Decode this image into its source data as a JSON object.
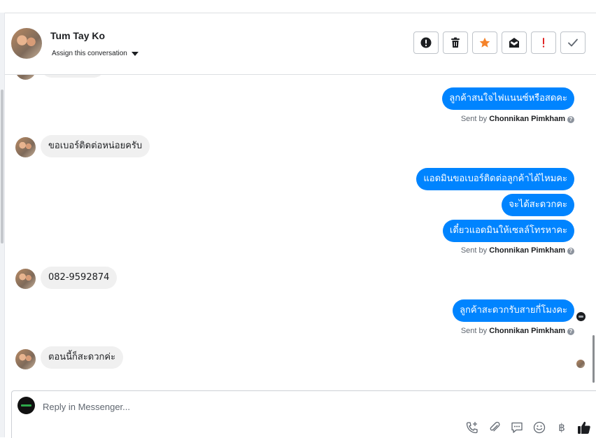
{
  "header": {
    "contact_name": "Tum Tay Ko",
    "assign_label": "Assign this conversation",
    "actions": [
      {
        "name": "spam-button",
        "icon": "alert-circle-icon"
      },
      {
        "name": "delete-button",
        "icon": "trash-icon"
      },
      {
        "name": "star-button",
        "icon": "star-icon",
        "color": "#f5832a"
      },
      {
        "name": "mark-unread-button",
        "icon": "mail-icon"
      },
      {
        "name": "follow-up-button",
        "icon": "exclamation-icon",
        "color": "#e02424"
      },
      {
        "name": "mark-done-button",
        "icon": "check-icon"
      }
    ]
  },
  "thread": {
    "messages": [
      {
        "from": "page",
        "text": "ลูกค้าสนใจไฟแนนซ์หรือสดคะ"
      },
      {
        "from": "page",
        "sent_by_prefix": "Sent by",
        "sent_by_name": "Chonnikan Pimkham"
      },
      {
        "from": "customer",
        "text": "ขอเบอร์ติดต่อหน่อยครับ"
      },
      {
        "from": "page",
        "text": "แอดมินขอเบอร์ติดต่อลูกค้าได้ไหมคะ"
      },
      {
        "from": "page",
        "text": "จะได้สะดวกคะ"
      },
      {
        "from": "page",
        "text": "เดี๋ยวแอดมินให้เซลล์โทรหาคะ"
      },
      {
        "from": "page",
        "sent_by_prefix": "Sent by",
        "sent_by_name": "Chonnikan Pimkham"
      },
      {
        "from": "customer",
        "text": "082-9592874"
      },
      {
        "from": "page",
        "text": "ลูกค้าสะดวกรับสายกี่โมงคะ"
      },
      {
        "from": "page",
        "sent_by_prefix": "Sent by",
        "sent_by_name": "Chonnikan Pimkham"
      },
      {
        "from": "customer",
        "text": "ตอนนี้ก็สะดวกค่ะ"
      }
    ]
  },
  "composer": {
    "placeholder": "Reply in Messenger...",
    "value": "",
    "tools": [
      "phone-add-icon",
      "attachment-icon",
      "saved-reply-icon",
      "emoji-icon",
      "payment-baht-icon",
      "thumbs-up-icon"
    ],
    "baht_symbol": "฿"
  },
  "colors": {
    "outgoing_bubble": "#0084ff",
    "incoming_bubble": "#f0f0f0",
    "star": "#f5832a",
    "follow_up": "#e02424"
  }
}
